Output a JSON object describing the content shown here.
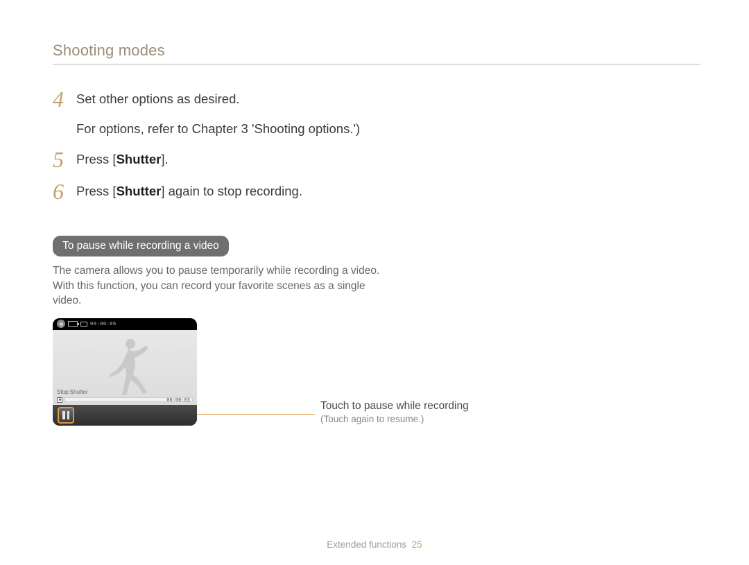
{
  "header": {
    "title": "Shooting modes"
  },
  "steps": {
    "s4": {
      "num": "4",
      "text": "Set other options as desired.",
      "sub": "For options, refer to Chapter 3 'Shooting options.')"
    },
    "s5": {
      "num": "5",
      "prefix": "Press [",
      "bold": "Shutter",
      "suffix": "]."
    },
    "s6": {
      "num": "6",
      "prefix": "Press [",
      "bold": "Shutter",
      "suffix": "] again to stop recording."
    }
  },
  "subsection": {
    "heading": "To pause while recording a video",
    "paragraph": "The camera allows you to pause temporarily while recording a video. With this function, you can record your favorite scenes as a single video."
  },
  "screen": {
    "timer_top": "00:00:06",
    "stop_label": "Stop:Shutter",
    "bar_timer": "00:00:03"
  },
  "callout": {
    "main": "Touch to pause while recording",
    "sub": "(Touch again to resume.)"
  },
  "footer": {
    "section": "Extended functions",
    "page": "25"
  }
}
